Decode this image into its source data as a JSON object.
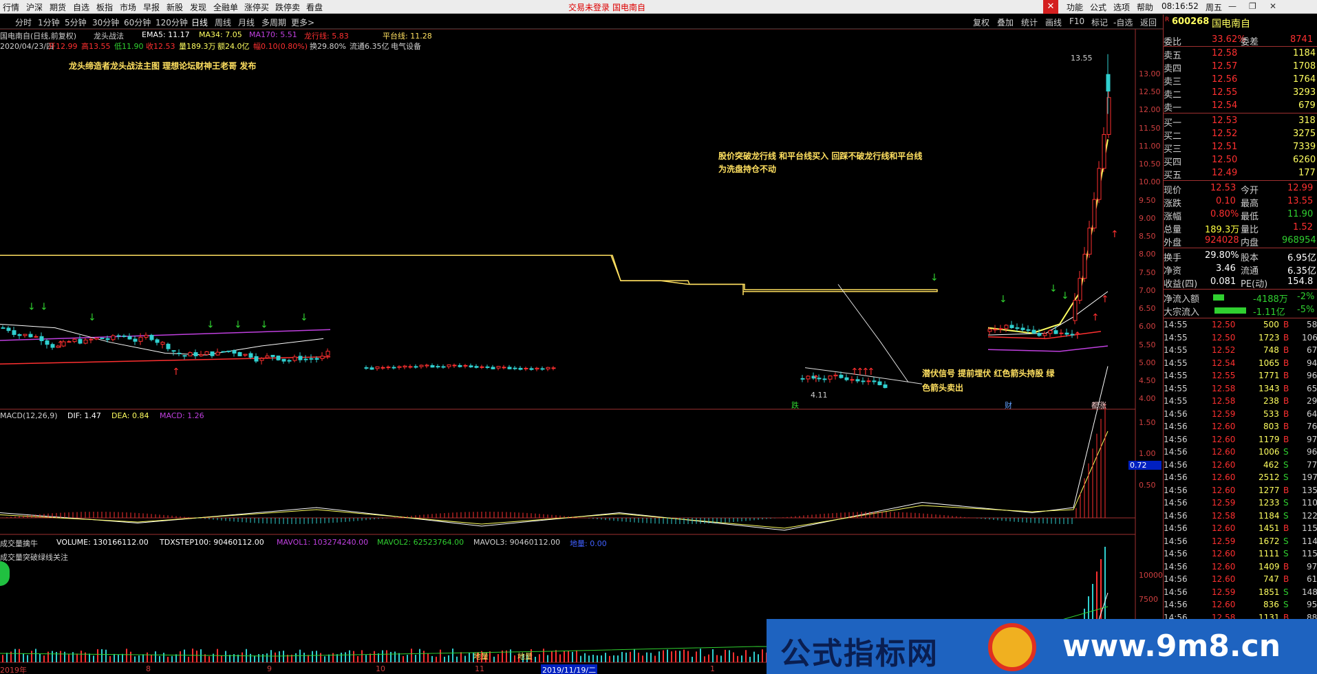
{
  "top_menu": {
    "items": [
      "行情",
      "沪深",
      "期货",
      "自选",
      "板指",
      "市场",
      "早报",
      "新股",
      "发现",
      "全融单",
      "涨停买",
      "跌停卖",
      "看盘"
    ],
    "center_notice": "交易未登录",
    "center_stock": "国电南自",
    "right_items": [
      "功能",
      "公式",
      "选项",
      "帮助"
    ],
    "time": "08:16:52",
    "weekday": "周五"
  },
  "period_bar": {
    "items": [
      "分时",
      "1分钟",
      "5分钟",
      "30分钟",
      "60分钟",
      "120分钟",
      "日线",
      "周线",
      "月线",
      "多周期",
      "更多>"
    ],
    "right_items": [
      "复权",
      "叠加",
      "统计",
      "画线",
      "F10",
      "标记",
      "-自选",
      "返回"
    ]
  },
  "main_info": {
    "title": "国电南自(日线,前复权)",
    "indicator_name": "龙头战法",
    "ema5": "EMA5: 11.17",
    "ma34": "MA34: 7.05",
    "ma170": "MA170: 5.51",
    "longhang": "龙行线: 5.83",
    "pingtai": "平台线: 11.28",
    "ohlc_date": "2020/04/23/四",
    "open": "开12.99",
    "high": "高13.55",
    "low": "低11.90",
    "close": "收12.53",
    "vol": "量189.3万",
    "amount": "额24.0亿",
    "change": "幅0.10(0.80%)",
    "turnover": "换29.80%",
    "float": "流通6.35亿",
    "sector": "电气设备"
  },
  "annotations": {
    "publisher": "龙头缔造者龙头战法主图 理想论坛财神王老哥 发布",
    "breakout_line1": "股价突破龙行线 和平台线买入 回踩不破龙行线和平台线",
    "breakout_line2": "为洗盘持仓不动",
    "signal_line1": "潜伏信号 提前埋伏 红色箭头持股 绿",
    "signal_line2": "色箭头卖出",
    "high_price": "13.55",
    "low_price": "4.11",
    "tag_die": "跌",
    "tag_cai": "财",
    "tag_zhang": "都涨",
    "diliang1": "地量",
    "diliang2": "地量"
  },
  "price_axis": [
    "13.00",
    "12.00",
    "11.00",
    "10.00",
    "9.00",
    "8.00",
    "7.00",
    "6.00",
    "5.00",
    "4.00",
    "12.50",
    "11.50",
    "10.50",
    "9.50",
    "8.50",
    "7.50",
    "6.50",
    "5.50",
    "4.50"
  ],
  "macd": {
    "label": "MACD(12,26,9)",
    "dif": "DIF: 1.47",
    "dea": "DEA: 0.84",
    "macd": "MACD: 1.26",
    "axis": [
      "1.50",
      "1.00",
      "0.50"
    ],
    "marker": "0.72"
  },
  "volume": {
    "label": "成交量擒牛",
    "volume": "VOLUME: 130166112.00",
    "tdxstep": "TDXSTEP100: 90460112.00",
    "mavol1": "MAVOL1: 103274240.00",
    "mavol2": "MAVOL2: 62523764.00",
    "mavol3": "MAVOL3: 90460112.00",
    "dl": "地量: 0.00",
    "note": "成交量突破绿线关注",
    "axis": [
      "10000",
      "7500"
    ]
  },
  "x_axis": {
    "labels": [
      "2019年",
      "8",
      "9",
      "10",
      "11",
      "1"
    ],
    "cursor_date": "2019/11/19/二"
  },
  "quote": {
    "code": "600268",
    "name": "国电南自",
    "weibi_label": "委比",
    "weibi": "33.62%",
    "weicha_label": "委差",
    "weicha": "8741",
    "asks": [
      {
        "label": "卖五",
        "price": "12.58",
        "vol": "1184"
      },
      {
        "label": "卖四",
        "price": "12.57",
        "vol": "1708"
      },
      {
        "label": "卖三",
        "price": "12.56",
        "vol": "1764"
      },
      {
        "label": "卖二",
        "price": "12.55",
        "vol": "3293"
      },
      {
        "label": "卖一",
        "price": "12.54",
        "vol": "679"
      }
    ],
    "bids": [
      {
        "label": "买一",
        "price": "12.53",
        "vol": "318"
      },
      {
        "label": "买二",
        "price": "12.52",
        "vol": "3275"
      },
      {
        "label": "买三",
        "price": "12.51",
        "vol": "7339"
      },
      {
        "label": "买四",
        "price": "12.50",
        "vol": "6260"
      },
      {
        "label": "买五",
        "price": "12.49",
        "vol": "177"
      }
    ],
    "stats": [
      {
        "l1": "现价",
        "v1": "12.53",
        "l2": "今开",
        "v2": "12.99",
        "c1": "#ff3030",
        "c2": "#ff3030"
      },
      {
        "l1": "涨跌",
        "v1": "0.10",
        "l2": "最高",
        "v2": "13.55",
        "c1": "#ff3030",
        "c2": "#ff3030"
      },
      {
        "l1": "涨幅",
        "v1": "0.80%",
        "l2": "最低",
        "v2": "11.90",
        "c1": "#ff3030",
        "c2": "#30d030"
      },
      {
        "l1": "总量",
        "v1": "189.3万",
        "l2": "量比",
        "v2": "1.52",
        "c1": "#ffff40",
        "c2": "#ff3030"
      },
      {
        "l1": "外盘",
        "v1": "924028",
        "l2": "内盘",
        "v2": "968954",
        "c1": "#ff3030",
        "c2": "#30d030"
      }
    ],
    "stats2": [
      {
        "l1": "换手",
        "v1": "29.80%",
        "l2": "股本",
        "v2": "6.95亿"
      },
      {
        "l1": "净资",
        "v1": "3.46",
        "l2": "流通",
        "v2": "6.35亿"
      },
      {
        "l1": "收益(四)",
        "v1": "0.081",
        "l2": "PE(动)",
        "v2": "154.8"
      }
    ],
    "flows": [
      {
        "label": "净流入额",
        "value": "-4188万",
        "pct": "-2%"
      },
      {
        "label": "大宗流入",
        "value": "-1.11亿",
        "pct": "-5%"
      }
    ],
    "ticks": [
      {
        "t": "14:55",
        "p": "12.50",
        "v": "500",
        "d": "B",
        "n": "58"
      },
      {
        "t": "14:55",
        "p": "12.50",
        "v": "1723",
        "d": "B",
        "n": "106"
      },
      {
        "t": "14:55",
        "p": "12.52",
        "v": "748",
        "d": "B",
        "n": "67"
      },
      {
        "t": "14:55",
        "p": "12.54",
        "v": "1065",
        "d": "B",
        "n": "94"
      },
      {
        "t": "14:55",
        "p": "12.55",
        "v": "1771",
        "d": "B",
        "n": "96"
      },
      {
        "t": "14:55",
        "p": "12.58",
        "v": "1343",
        "d": "B",
        "n": "65"
      },
      {
        "t": "14:55",
        "p": "12.58",
        "v": "238",
        "d": "B",
        "n": "29"
      },
      {
        "t": "14:56",
        "p": "12.59",
        "v": "533",
        "d": "B",
        "n": "64"
      },
      {
        "t": "14:56",
        "p": "12.60",
        "v": "803",
        "d": "B",
        "n": "76"
      },
      {
        "t": "14:56",
        "p": "12.60",
        "v": "1179",
        "d": "B",
        "n": "97"
      },
      {
        "t": "14:56",
        "p": "12.60",
        "v": "1006",
        "d": "S",
        "n": "96"
      },
      {
        "t": "14:56",
        "p": "12.60",
        "v": "462",
        "d": "S",
        "n": "77"
      },
      {
        "t": "14:56",
        "p": "12.60",
        "v": "2512",
        "d": "S",
        "n": "197"
      },
      {
        "t": "14:56",
        "p": "12.60",
        "v": "1277",
        "d": "B",
        "n": "135"
      },
      {
        "t": "14:56",
        "p": "12.59",
        "v": "1233",
        "d": "S",
        "n": "110"
      },
      {
        "t": "14:56",
        "p": "12.58",
        "v": "1184",
        "d": "S",
        "n": "122"
      },
      {
        "t": "14:56",
        "p": "12.60",
        "v": "1451",
        "d": "B",
        "n": "115"
      },
      {
        "t": "14:56",
        "p": "12.59",
        "v": "1672",
        "d": "S",
        "n": "114"
      },
      {
        "t": "14:56",
        "p": "12.60",
        "v": "1111",
        "d": "S",
        "n": "115"
      },
      {
        "t": "14:56",
        "p": "12.60",
        "v": "1409",
        "d": "B",
        "n": "97"
      },
      {
        "t": "14:56",
        "p": "12.60",
        "v": "747",
        "d": "B",
        "n": "61"
      },
      {
        "t": "14:56",
        "p": "12.59",
        "v": "1851",
        "d": "S",
        "n": "148"
      },
      {
        "t": "14:56",
        "p": "12.60",
        "v": "836",
        "d": "S",
        "n": "95"
      },
      {
        "t": "14:56",
        "p": "12.58",
        "v": "1131",
        "d": "B",
        "n": "88"
      }
    ]
  },
  "watermark": {
    "cn": "公式指标网",
    "url": "www.9m8.cn"
  },
  "colors": {
    "up": "#ff3030",
    "down": "#30d0d0",
    "ema": "#ffffff",
    "ma34": "#ffff60",
    "ma170": "#c040e0",
    "longhang": "#ff3030",
    "pingtai": "#ffe060"
  }
}
